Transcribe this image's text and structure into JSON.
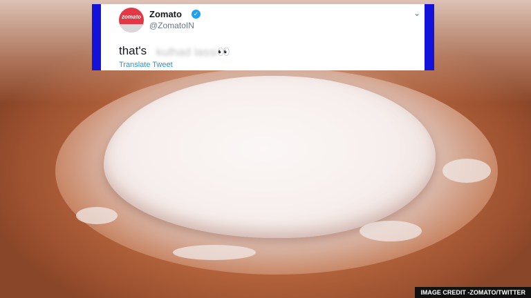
{
  "tweet": {
    "name": "Zomato",
    "handle": "@ZomatoIN",
    "avatar_text": "zomato",
    "text_prefix": "that's",
    "text_blurred": "kulhad lassi",
    "emoji": "👀",
    "translate_label": "Translate Tweet",
    "verified_icon": "verified-badge-icon",
    "chevron_icon": "chevron-down-icon"
  },
  "image": {
    "credit": "IMAGE CREDIT -ZOMATO/TWITTER"
  },
  "colors": {
    "frame_blue": "#1212d8",
    "brand_red": "#e23744",
    "link_blue": "#1b95e0"
  }
}
